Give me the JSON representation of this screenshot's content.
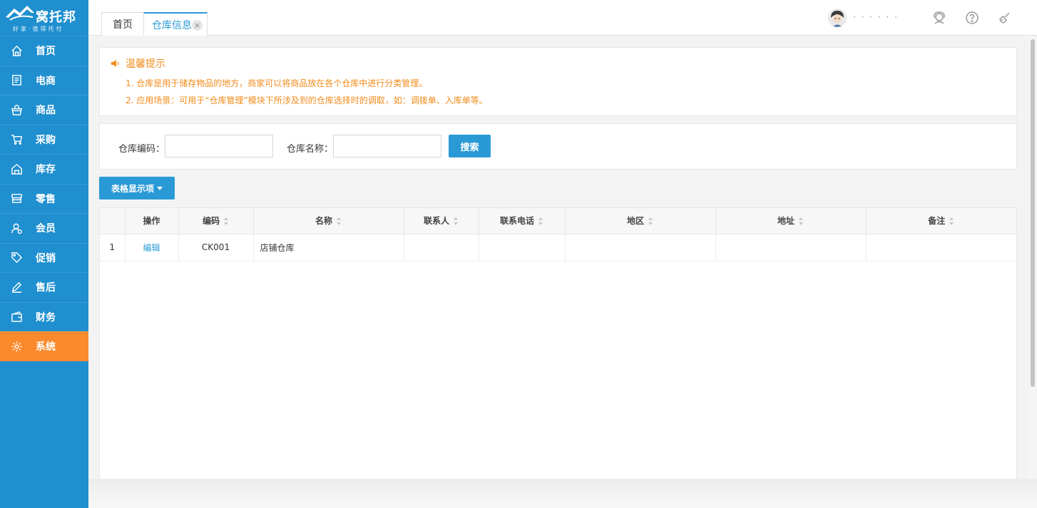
{
  "app": {
    "brand": "窝托邦",
    "slogan": "好家·值得托付"
  },
  "sidebar": {
    "items": [
      {
        "label": "首页",
        "icon": "home-icon",
        "active": false
      },
      {
        "label": "电商",
        "icon": "document-icon",
        "active": false
      },
      {
        "label": "商品",
        "icon": "basket-icon",
        "active": false
      },
      {
        "label": "采购",
        "icon": "cart-icon",
        "active": false
      },
      {
        "label": "库存",
        "icon": "warehouse-icon",
        "active": false
      },
      {
        "label": "零售",
        "icon": "store-icon",
        "active": false
      },
      {
        "label": "会员",
        "icon": "member-icon",
        "active": false
      },
      {
        "label": "促销",
        "icon": "tag-icon",
        "active": false
      },
      {
        "label": "售后",
        "icon": "pen-icon",
        "active": false
      },
      {
        "label": "财务",
        "icon": "wallet-icon",
        "active": false
      },
      {
        "label": "系统",
        "icon": "gear-icon",
        "active": true
      }
    ],
    "active_color": "#fb8a2c",
    "bg_color": "#1f8fcf"
  },
  "tabs": {
    "home": "首页",
    "active": "仓库信息",
    "close_glyph": "×"
  },
  "header": {
    "username": "·  ·  ·  ·  ·  ·"
  },
  "tips": {
    "title": "温馨提示",
    "lines": [
      "1. 仓库是用于储存物品的地方，商家可以将商品放在各个仓库中进行分类管理。",
      "2. 应用场景：可用于“仓库管理”模块下所涉及到的仓库选择时的调取，如：调拨单、入库单等。"
    ]
  },
  "search": {
    "code_label": "仓库编码：",
    "code_value": "",
    "name_label": "仓库名称：",
    "name_value": "",
    "button": "搜索"
  },
  "toolbar": {
    "columns_button": "表格显示项"
  },
  "table": {
    "columns": [
      "",
      "操作",
      "编码",
      "名称",
      "联系人",
      "联系电话",
      "地区",
      "地址",
      "备注"
    ],
    "rows": [
      {
        "index": "1",
        "action": "编辑",
        "code": "CK001",
        "name": "店铺仓库",
        "contact": "",
        "phone": "",
        "region": "",
        "address": "",
        "remark": ""
      }
    ]
  },
  "colors": {
    "primary": "#2a9ad6",
    "warning": "#f28b1b"
  }
}
